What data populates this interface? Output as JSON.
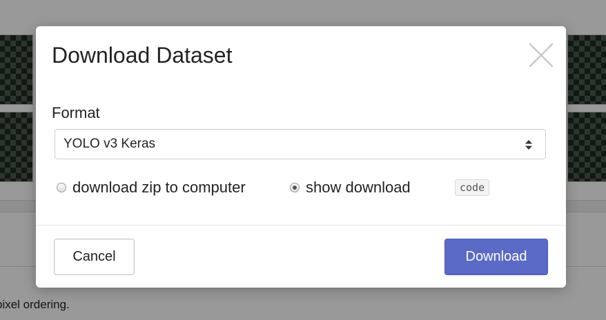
{
  "background": {
    "footer_text": "pixel ordering."
  },
  "modal": {
    "title": "Download Dataset",
    "close_icon": "close-icon",
    "format": {
      "label": "Format",
      "selected": "YOLO v3 Keras",
      "icon": "select-arrows-icon"
    },
    "options": [
      {
        "label": "download zip to computer",
        "checked": false
      },
      {
        "label": "show download",
        "checked": true,
        "badge": "code"
      }
    ],
    "buttons": {
      "cancel": "Cancel",
      "download": "Download"
    },
    "colors": {
      "primary": "#5a6ac6",
      "overlay": "#000000"
    }
  }
}
